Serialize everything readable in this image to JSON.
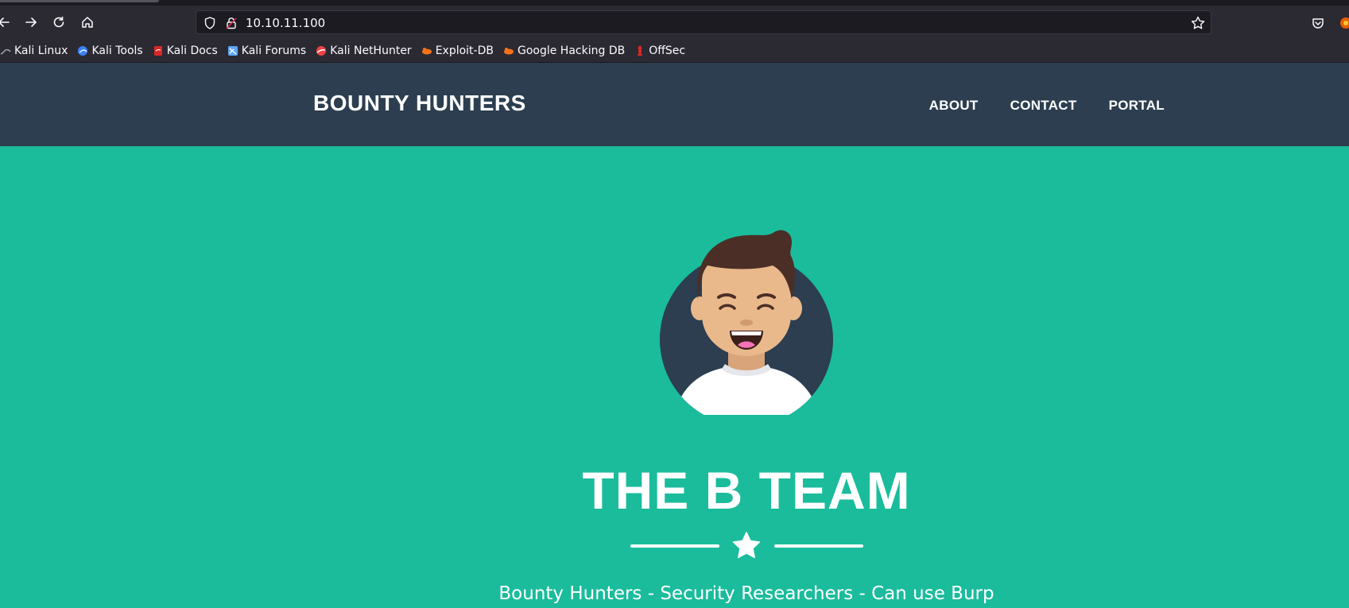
{
  "browser": {
    "url": "10.10.11.100",
    "bookmarks": [
      {
        "label": "Kali Linux",
        "icon": "kali-dragon-icon",
        "color": "#9ca3af"
      },
      {
        "label": "Kali Tools",
        "icon": "kali-tools-icon",
        "color": "#3b82f6"
      },
      {
        "label": "Kali Docs",
        "icon": "kali-docs-icon",
        "color": "#dc2626"
      },
      {
        "label": "Kali Forums",
        "icon": "kali-forums-icon",
        "color": "#60a5fa"
      },
      {
        "label": "Kali NetHunter",
        "icon": "kali-nethunter-icon",
        "color": "#ef4444"
      },
      {
        "label": "Exploit-DB",
        "icon": "exploit-db-icon",
        "color": "#f97316"
      },
      {
        "label": "Google Hacking DB",
        "icon": "ghdb-icon",
        "color": "#f97316"
      },
      {
        "label": "OffSec",
        "icon": "offsec-icon",
        "color": "#dc2626"
      }
    ]
  },
  "site": {
    "brand": "BOUNTY HUNTERS",
    "nav": [
      "ABOUT",
      "CONTACT",
      "PORTAL"
    ],
    "hero_title": "THE B TEAM",
    "subtitle": "Bounty Hunters - Security Researchers - Can use Burp"
  },
  "colors": {
    "header_bg": "#2c3e50",
    "hero_bg": "#1abc9c",
    "text": "#ffffff"
  }
}
